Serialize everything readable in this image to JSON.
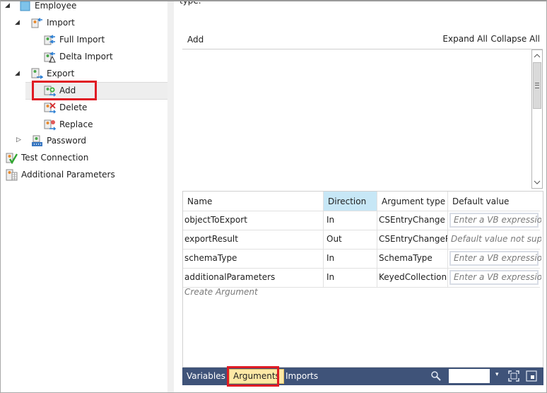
{
  "tree": {
    "items": [
      {
        "label": "Employee",
        "icon": "object-type-icon",
        "toggle": "expanded"
      },
      {
        "label": "Import",
        "icon": "import-icon",
        "toggle": "expanded"
      },
      {
        "label": "Full Import",
        "icon": "full-import-icon"
      },
      {
        "label": "Delta Import",
        "icon": "delta-import-icon"
      },
      {
        "label": "Export",
        "icon": "export-icon",
        "toggle": "expanded"
      },
      {
        "label": "Add",
        "icon": "export-add-icon",
        "selected": true
      },
      {
        "label": "Delete",
        "icon": "export-delete-icon"
      },
      {
        "label": "Replace",
        "icon": "export-replace-icon"
      },
      {
        "label": "Password",
        "icon": "password-icon",
        "toggle": "collapsed"
      },
      {
        "label": "Test Connection",
        "icon": "test-connection-icon"
      },
      {
        "label": "Additional Parameters",
        "icon": "additional-parameters-icon"
      }
    ],
    "toggle_glyphs": {
      "expanded": "◢",
      "collapsed": "▷"
    }
  },
  "main": {
    "description_tail": "type.",
    "designer": {
      "title": "Add",
      "expand_all": "Expand All",
      "collapse_all": "Collapse All",
      "scroll_up": "^",
      "scroll_down": "v"
    },
    "arguments": {
      "columns": [
        "Name",
        "Direction",
        "Argument type",
        "Default value"
      ],
      "rows": [
        {
          "name": "objectToExport",
          "direction": "In",
          "type": "CSEntryChange",
          "default_placeholder": "Enter a VB expression",
          "editable": true
        },
        {
          "name": "exportResult",
          "direction": "Out",
          "type": "CSEntryChangeResult",
          "default_text": "Default value not supported",
          "editable": false
        },
        {
          "name": "schemaType",
          "direction": "In",
          "type": "SchemaType",
          "default_placeholder": "Enter a VB expression",
          "editable": true
        },
        {
          "name": "additionalParameters",
          "direction": "In",
          "type": "KeyedCollection<String, ConfigParameter>",
          "default_placeholder": "Enter a VB expression",
          "editable": true
        }
      ],
      "create_argument": "Create Argument"
    },
    "bottom_bar": {
      "tabs": [
        {
          "label": "Variables",
          "active": false
        },
        {
          "label": "Arguments",
          "active": true
        },
        {
          "label": "Imports",
          "active": false
        }
      ],
      "zoom_value": "",
      "dropdown_glyph": "▾"
    }
  },
  "colors": {
    "highlight_border": "#e01b24",
    "bottom_bar": "#3f5379",
    "active_tab": "#fde9a6",
    "header_sorted": "#c7e7f6"
  }
}
